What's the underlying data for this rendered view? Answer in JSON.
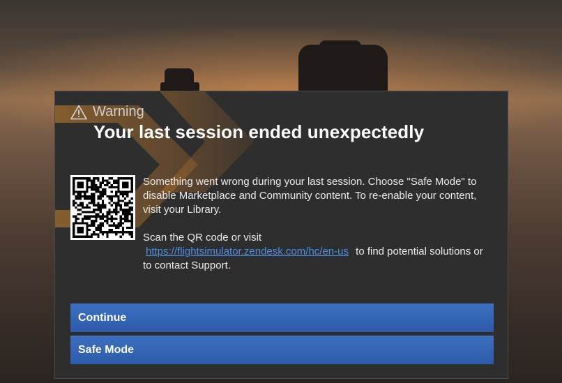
{
  "dialog": {
    "warning_label": "Warning",
    "title": "Your last session ended unexpectedly",
    "paragraph1": "Something went wrong during your last session. Choose \"Safe Mode\" to disable Marketplace and Community content. To re-enable your content, visit your Library.",
    "paragraph2_prefix": "Scan the QR code or visit",
    "support_link": "https://flightsimulator.zendesk.com/hc/en-us",
    "paragraph2_suffix": "to find potential solutions or to contact Support.",
    "icons": {
      "warning": "warning-triangle-icon",
      "qr": "qr-code"
    }
  },
  "buttons": {
    "continue_label": "Continue",
    "safe_mode_label": "Safe Mode"
  },
  "colors": {
    "dialog_bg": "#2e2e2f",
    "button_blue": "#3465b5",
    "link": "#4a8fe6",
    "accent_orange": "#d68a2e"
  }
}
